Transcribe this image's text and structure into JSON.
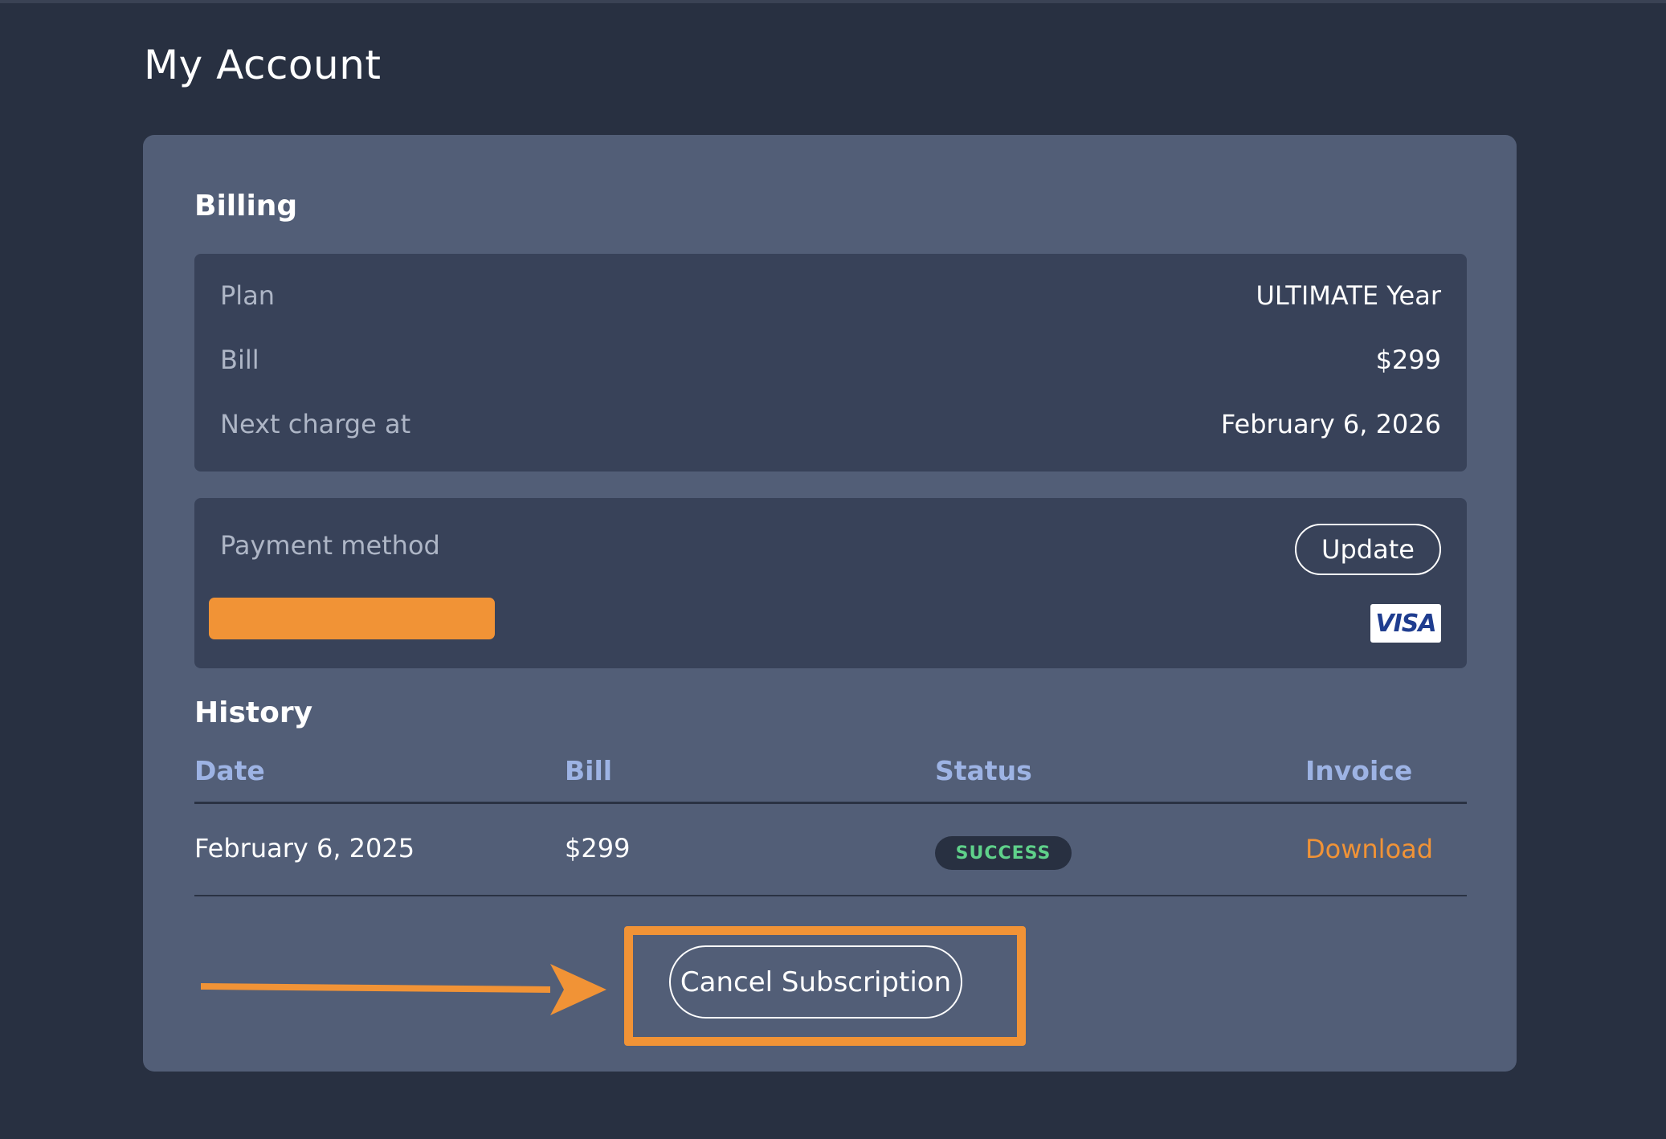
{
  "page": {
    "title": "My Account"
  },
  "billing": {
    "heading": "Billing",
    "rows": [
      {
        "label": "Plan",
        "value": "ULTIMATE Year"
      },
      {
        "label": "Bill",
        "value": "$299"
      },
      {
        "label": "Next charge at",
        "value": "February 6, 2026"
      }
    ],
    "payment": {
      "label": "Payment method",
      "update_label": "Update",
      "card_brand": "VISA",
      "card_number_redacted": true
    }
  },
  "history": {
    "heading": "History",
    "columns": [
      "Date",
      "Bill",
      "Status",
      "Invoice"
    ],
    "rows": [
      {
        "date": "February 6, 2025",
        "bill": "$299",
        "status": "SUCCESS",
        "invoice": "Download"
      }
    ]
  },
  "actions": {
    "cancel_label": "Cancel Subscription"
  },
  "colors": {
    "background": "#283041",
    "card": "#525e77",
    "panel": "#384259",
    "accent_orange": "#f19336",
    "header_blue": "#9db3e4",
    "success_green": "#5fd18a"
  },
  "annotation": {
    "arrow_target": "cancel-subscription-button",
    "highlight_color": "#f19336"
  }
}
